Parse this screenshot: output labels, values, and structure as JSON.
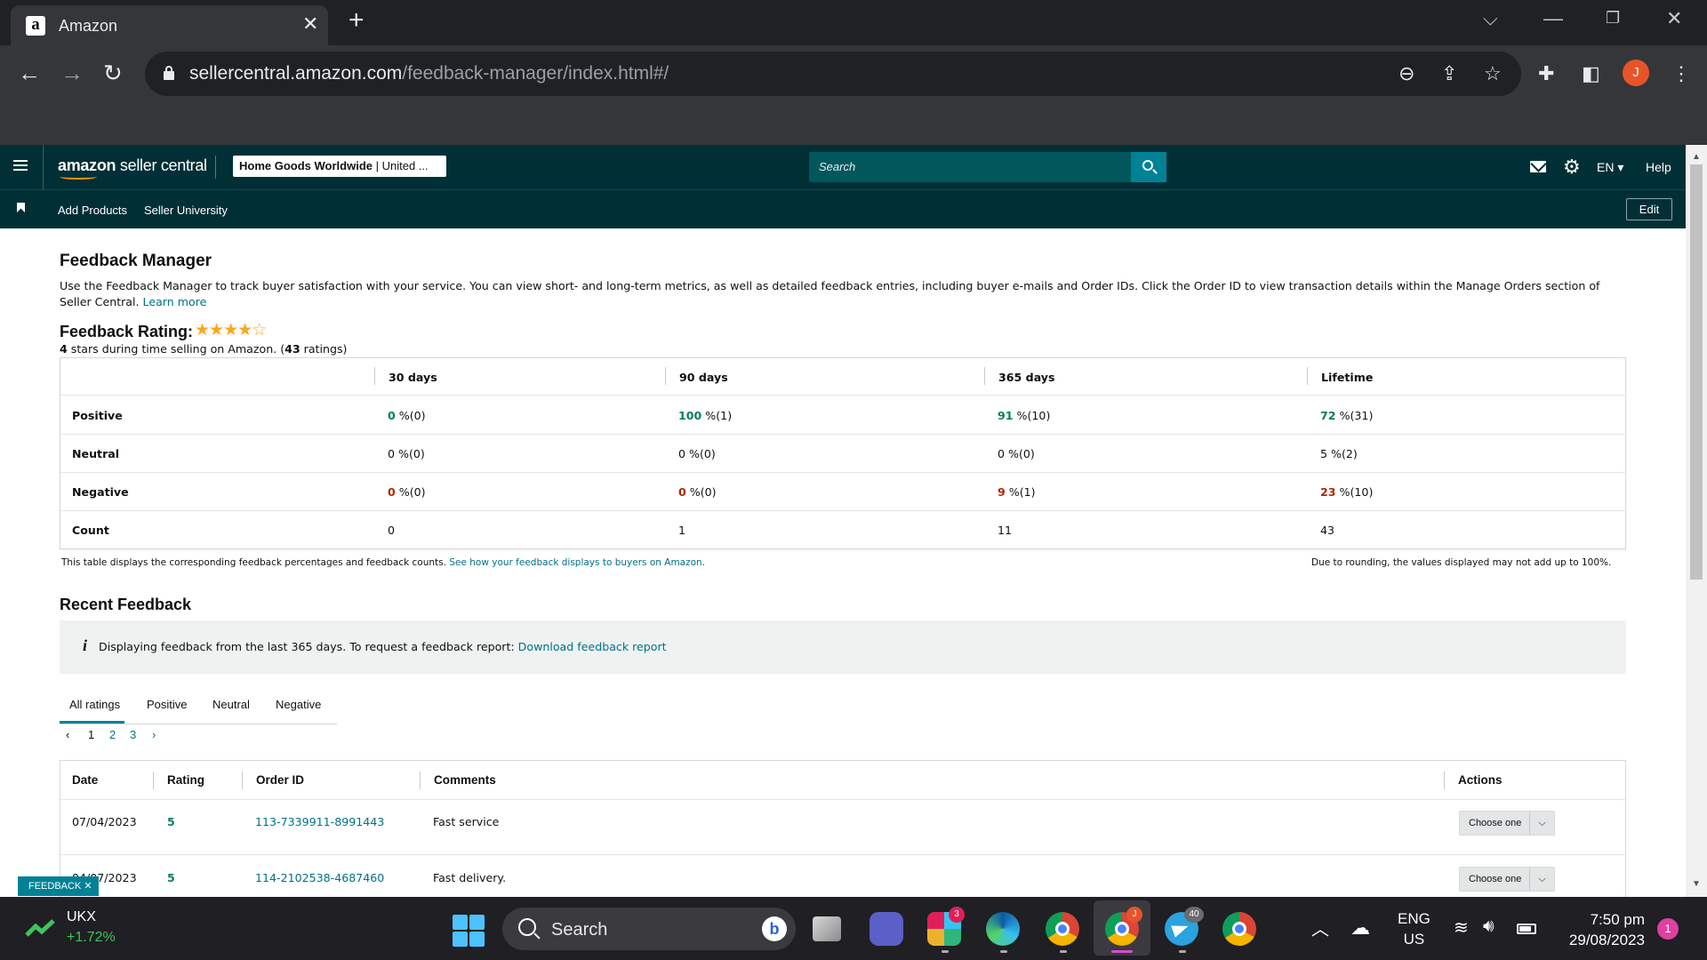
{
  "browser": {
    "tab_title": "Amazon",
    "favicon_letter": "a",
    "url_host": "sellercentral.amazon.com",
    "url_path": "/feedback-manager/index.html#/",
    "profile_initial": "J"
  },
  "header": {
    "logo_bold": "amazon",
    "logo_rest": " seller central",
    "store_name": "Home Goods Worldwide",
    "store_region": " | United ...",
    "search_placeholder": "Search",
    "language": "EN ▾",
    "help": "Help",
    "nav_links": [
      "Add Products",
      "Seller University"
    ],
    "edit": "Edit"
  },
  "page": {
    "title": "Feedback Manager",
    "intro": "Use the Feedback Manager to track buyer satisfaction with your service. You can view short- and long-term metrics, as well as detailed feedback entries, including buyer e-mails and Order IDs. Click the Order ID to view transaction details within the Manage Orders section of Seller Central.",
    "learn_more": "Learn more",
    "rating_title": "Feedback Rating:",
    "rating_stars": 4,
    "rating_max": 5,
    "rating_sub_pre": "4",
    "rating_sub_mid": " stars during time selling on Amazon. (",
    "rating_sub_count": "43",
    "rating_sub_post": " ratings)"
  },
  "metrics": {
    "columns": [
      "30 days",
      "90 days",
      "365 days",
      "Lifetime"
    ],
    "rows": [
      {
        "label": "Positive",
        "cells": [
          [
            "0",
            " %(0)"
          ],
          [
            "100",
            " %(1)"
          ],
          [
            "91",
            " %(10)"
          ],
          [
            "72",
            " %(31)"
          ]
        ]
      },
      {
        "label": "Neutral",
        "cells": [
          [
            "0",
            " %(0)"
          ],
          [
            "0",
            " %(0)"
          ],
          [
            "0",
            " %(0)"
          ],
          [
            "5",
            " %(2)"
          ]
        ]
      },
      {
        "label": "Negative",
        "cells": [
          [
            "0",
            " %(0)"
          ],
          [
            "0",
            " %(0)"
          ],
          [
            "9",
            " %(1)"
          ],
          [
            "23",
            " %(10)"
          ]
        ]
      },
      {
        "label": "Count",
        "cells": [
          [
            "0",
            ""
          ],
          [
            "1",
            ""
          ],
          [
            "11",
            ""
          ],
          [
            "43",
            ""
          ]
        ]
      }
    ],
    "note_left": "This table displays the corresponding feedback percentages and feedback counts.",
    "note_link": "See how your feedback displays to buyers on Amazon.",
    "note_right": "Due to rounding, the values displayed may not add up to 100%."
  },
  "recent": {
    "title": "Recent Feedback",
    "info_icon": "i",
    "info_text": "Displaying feedback from the last 365 days. To request a feedback report:",
    "info_link": "Download feedback report",
    "tabs": [
      "All ratings",
      "Positive",
      "Neutral",
      "Negative"
    ],
    "pages": [
      "‹",
      "1",
      "2",
      "3",
      "›"
    ],
    "columns": [
      "Date",
      "Rating",
      "Order ID",
      "Comments",
      "Actions"
    ],
    "rows": [
      {
        "date": "07/04/2023",
        "rating": "5",
        "order_id": "113-7339911-8991443",
        "comment": "Fast service",
        "action": "Choose one"
      },
      {
        "date": "04/07/2023",
        "rating": "5",
        "order_id": "114-2102538-4687460",
        "comment": "Fast delivery.",
        "action": "Choose one"
      }
    ],
    "feedback_tag": "FEEDBACK ✕"
  },
  "taskbar": {
    "ticker_name": "UKX",
    "ticker_change": "+1.72%",
    "search": "Search",
    "slack_badge": "3",
    "telegram_badge": "40",
    "lang_top": "ENG",
    "lang_bottom": "US",
    "time": "7:50 pm",
    "date": "29/08/2023",
    "notifications": "1"
  },
  "colors": {
    "header_bg": "#002f36",
    "link": "#007185",
    "positive": "#067d62",
    "negative": "#b12704",
    "star": "#ffa41c"
  }
}
